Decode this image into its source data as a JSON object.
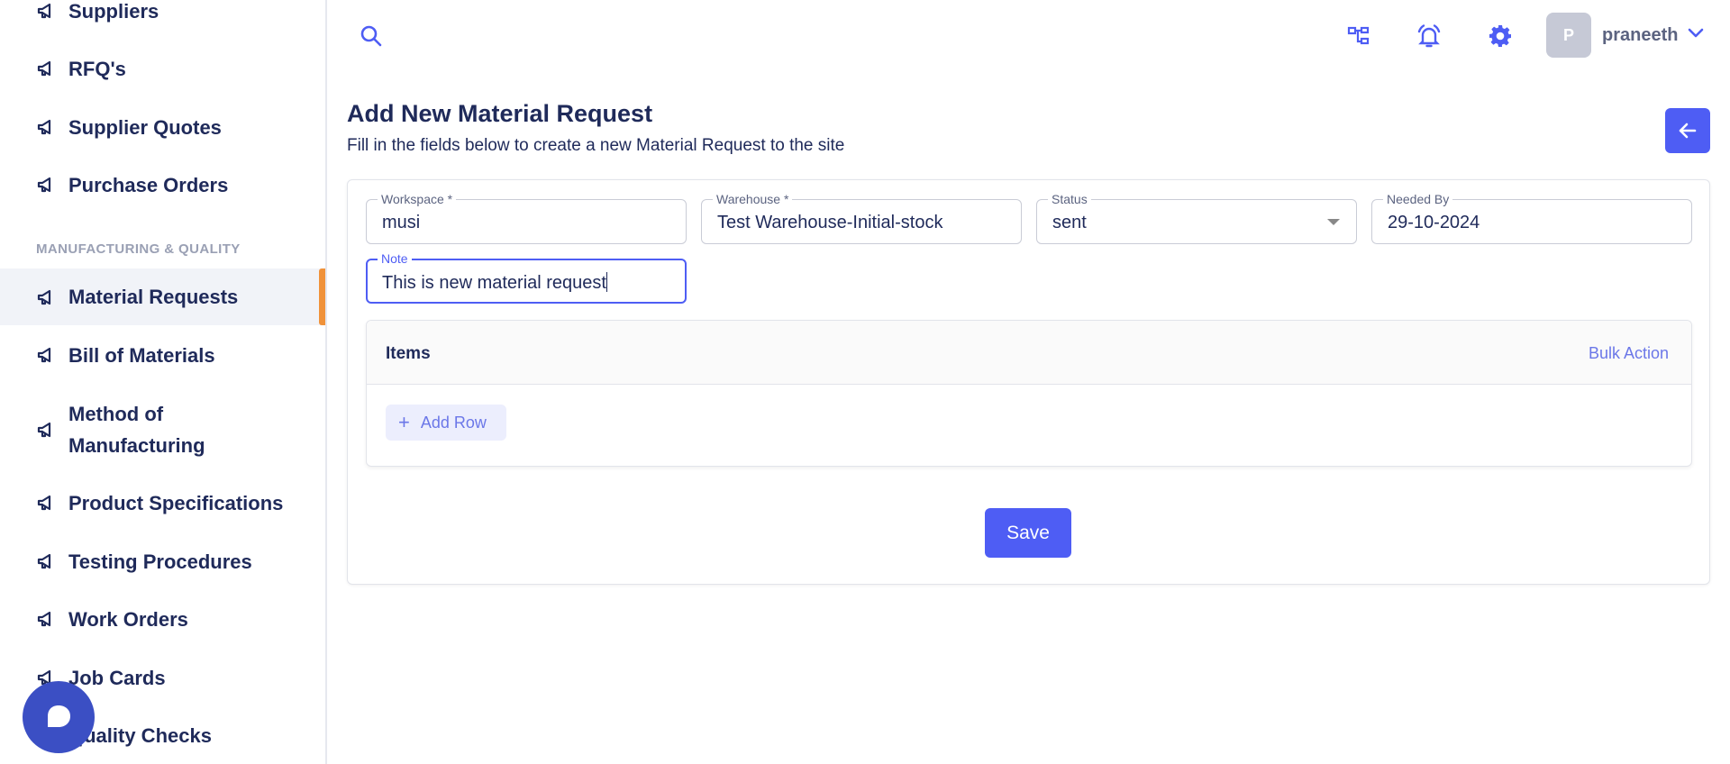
{
  "sidebar": {
    "section_manufacturing": "MANUFACTURING & QUALITY",
    "items": [
      {
        "label": "Suppliers"
      },
      {
        "label": "RFQ's"
      },
      {
        "label": "Supplier Quotes"
      },
      {
        "label": "Purchase Orders"
      },
      {
        "label": "Material Requests",
        "active": true
      },
      {
        "label": "Bill of Materials"
      },
      {
        "label": "Method of",
        "label2": "Manufacturing"
      },
      {
        "label": "Product Specifications"
      },
      {
        "label": "Testing Procedures"
      },
      {
        "label": "Work Orders"
      },
      {
        "label": "Job Cards"
      },
      {
        "label": "Quality Checks"
      }
    ],
    "item_icon": "megaphone-icon"
  },
  "topbar": {
    "icons": [
      "search-icon",
      "sitemap-icon",
      "bell-icon",
      "gear-icon",
      "chevron-down-icon"
    ],
    "avatar_initial": "P",
    "username": "praneeth"
  },
  "header": {
    "title": "Add New Material Request",
    "subtitle": "Fill in the fields below to create a new Material Request to the site"
  },
  "form": {
    "workspace": {
      "label": "Workspace *",
      "value": "musi"
    },
    "warehouse": {
      "label": "Warehouse *",
      "value": "Test Warehouse-Initial-stock"
    },
    "status": {
      "label": "Status",
      "value": "sent"
    },
    "needed_by": {
      "label": "Needed By",
      "value": "29-10-2024"
    },
    "note": {
      "label": "Note",
      "value": "This is new material request"
    }
  },
  "items": {
    "title": "Items",
    "bulk_action": "Bulk Action",
    "add_row": "Add Row"
  },
  "actions": {
    "save": "Save"
  },
  "colors": {
    "primary": "#4e5df4",
    "accent_active": "#f0923a",
    "nav_text": "#1f2a5a"
  }
}
